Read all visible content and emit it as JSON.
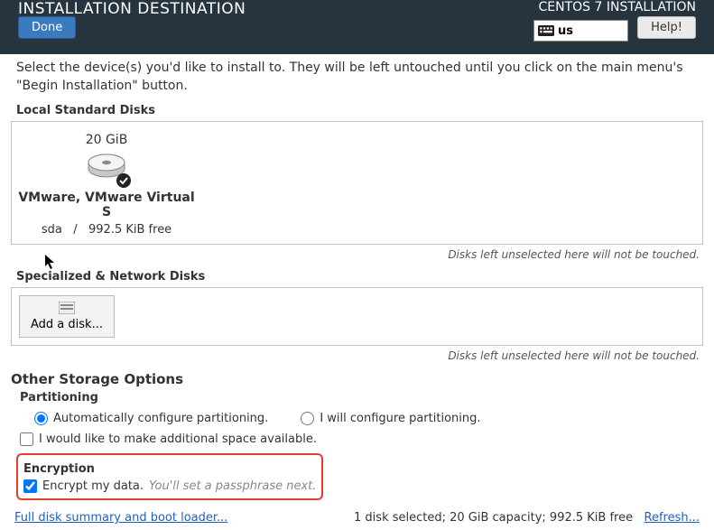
{
  "topbar": {
    "title": "INSTALLATION DESTINATION",
    "subtitle": "CENTOS 7 INSTALLATION",
    "done": "Done",
    "help": "Help!",
    "kb_layout": "us"
  },
  "instructions": "Select the device(s) you'd like to install to. They will be left untouched until you click on the main menu's \"Begin Installation\" button.",
  "local_disks": {
    "label": "Local Standard Disks",
    "items": [
      {
        "size": "20 GiB",
        "name": "VMware, VMware Virtual S",
        "dev": "sda",
        "sep": "/",
        "free": "992.5 KiB free",
        "selected": true
      }
    ],
    "hint": "Disks left unselected here will not be touched."
  },
  "network_disks": {
    "label": "Specialized & Network Disks",
    "add_button": "Add a disk...",
    "hint": "Disks left unselected here will not be touched."
  },
  "other": {
    "heading": "Other Storage Options",
    "partitioning": {
      "label": "Partitioning",
      "auto": "Automatically configure partitioning.",
      "manual": "I will configure partitioning.",
      "reclaim": "I would like to make additional space available."
    },
    "encryption": {
      "label": "Encryption",
      "encrypt": "Encrypt my data.",
      "hint": "You'll set a passphrase next."
    }
  },
  "footer": {
    "summary_link": "Full disk summary and boot loader...",
    "status": "1 disk selected; 20 GiB capacity; 992.5 KiB free",
    "refresh": "Refresh..."
  }
}
